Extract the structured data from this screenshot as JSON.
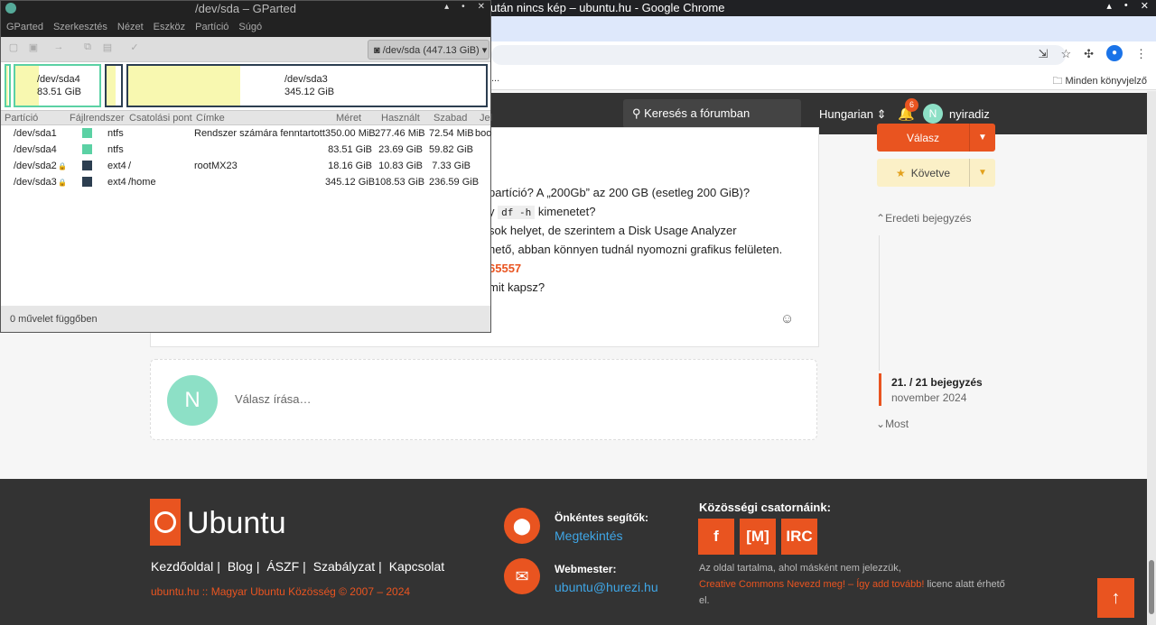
{
  "chrome": {
    "title": "után nincs kép – ubuntu.hu - Google Chrome",
    "window_buttons": [
      "▴",
      "•",
      "✕"
    ],
    "bookmarks_more": "...",
    "bookmarks_all": "Minden könyvjelző"
  },
  "forum": {
    "search_label": "Keresés a fórumban",
    "language": "Hungarian",
    "notif_count": "6",
    "user_initial": "N",
    "username": "nyiradiz",
    "post": {
      "line1": "partíció? A „200Gb” az 200 GB (esetleg 200 GiB)?",
      "line2_pre": "y",
      "line2_code": "df -h",
      "line2_post": "kimenetet?",
      "line3": "sok helyet, de szerintem a Disk Usage Analyzer",
      "line4": "hető, abban könnyen tudnál nyomozni grafikus felületen.",
      "line5": "65557",
      "line6": "mit kapsz?"
    },
    "reply_initial": "N",
    "reply_placeholder": "Válasz írása…",
    "btn_reply": "Válasz",
    "btn_follow": "Követve",
    "timeline_original": "Eredeti bejegyzés",
    "timeline_count": "21. / 21 bejegyzés",
    "timeline_date": "november 2024",
    "timeline_now": "Most"
  },
  "footer": {
    "brand": "Ubuntu",
    "links": [
      "Kezdőoldal",
      "Blog",
      "ÁSZF",
      "Szabályzat",
      "Kapcsolat"
    ],
    "copyright": "ubuntu.hu :: Magyar Ubuntu Közösség © 2007 – 2024",
    "volunteers_title": "Önkéntes segítők:",
    "volunteers_link": "Megtekintés",
    "webmaster_title": "Webmester:",
    "webmaster_email": "ubuntu@hurezi.hu",
    "community_title": "Közösségi csatornáink:",
    "social": [
      "f",
      "[M]",
      "IRC"
    ],
    "license_pre": "Az oldal tartalma, ahol másként nem jelezzük,",
    "license_link": "Creative Commons Nevezd meg! – Így add tovább!",
    "license_post": "licenc alatt érhető el."
  },
  "gparted": {
    "title": "/dev/sda – GParted",
    "menu": [
      "GParted",
      "Szerkesztés",
      "Nézet",
      "Eszköz",
      "Partíció",
      "Súgó"
    ],
    "device": "/dev/sda (447.13 GiB)",
    "map": {
      "sda4_name": "/dev/sda4",
      "sda4_size": "83.51 GiB",
      "sda3_name": "/dev/sda3",
      "sda3_size": "345.12 GiB",
      "sda4_used_fraction": 0.284,
      "sda3_used_fraction": 0.314
    },
    "columns": [
      "Partíció",
      "Fájlrendszer",
      "Csatolási pont",
      "Címke",
      "Méret",
      "Használt",
      "Szabad",
      "Jel"
    ],
    "rows": [
      {
        "name": "/dev/sda1",
        "lock": "",
        "color": "#5bd1a4",
        "fs": "ntfs",
        "mount": "",
        "label": "Rendszer számára fenntartott",
        "size": "350.00 MiB",
        "used": "277.46 MiB",
        "free": "72.54 MiB",
        "flags": "boo"
      },
      {
        "name": "/dev/sda4",
        "lock": "",
        "color": "#5bd1a4",
        "fs": "ntfs",
        "mount": "",
        "label": "",
        "size": "83.51 GiB",
        "used": "23.69 GiB",
        "free": "59.82 GiB",
        "flags": ""
      },
      {
        "name": "/dev/sda2",
        "lock": "🔒",
        "color": "#2c3e50",
        "fs": "ext4",
        "mount": "/",
        "label": "rootMX23",
        "size": "18.16 GiB",
        "used": "10.83 GiB",
        "free": "7.33 GiB",
        "flags": ""
      },
      {
        "name": "/dev/sda3",
        "lock": "🔒",
        "color": "#2c3e50",
        "fs": "ext4",
        "mount": "/home",
        "label": "",
        "size": "345.12 GiB",
        "used": "108.53 GiB",
        "free": "236.59 GiB",
        "flags": ""
      }
    ],
    "status": "0 művelet függőben"
  }
}
